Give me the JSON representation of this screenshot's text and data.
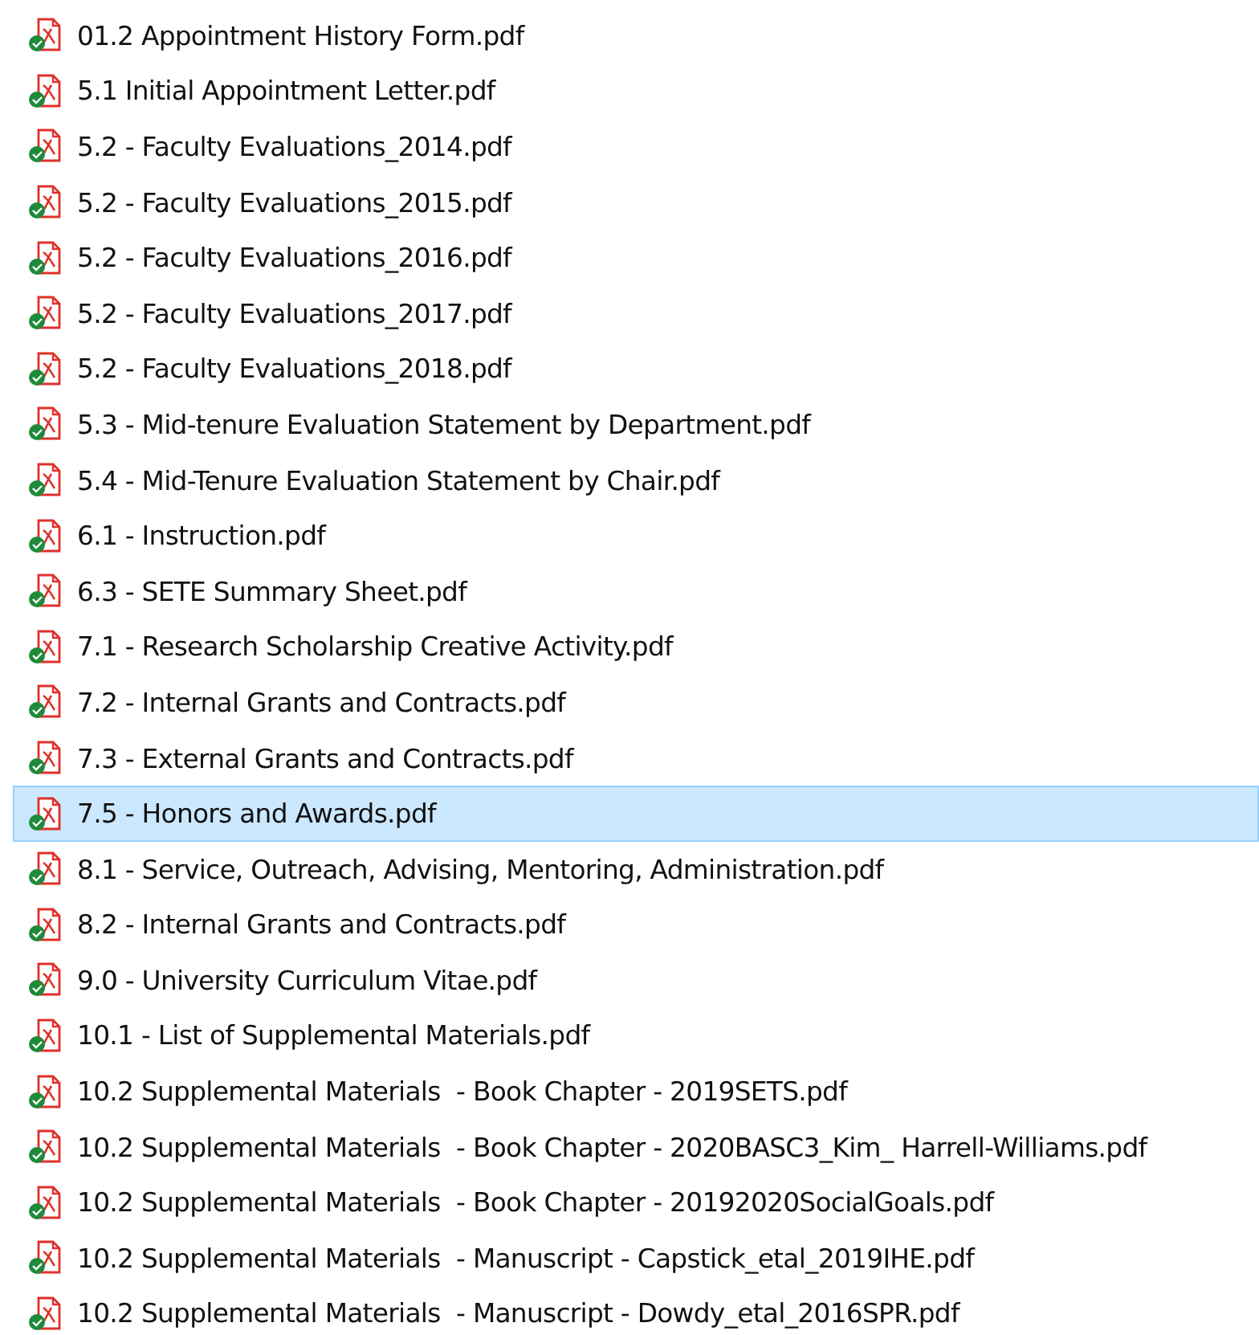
{
  "files": [
    {
      "name": "01.2 Appointment History Form.pdf",
      "selected": false
    },
    {
      "name": "5.1 Initial Appointment Letter.pdf",
      "selected": false
    },
    {
      "name": "5.2 - Faculty Evaluations_2014.pdf",
      "selected": false
    },
    {
      "name": "5.2 - Faculty Evaluations_2015.pdf",
      "selected": false
    },
    {
      "name": "5.2 - Faculty Evaluations_2016.pdf",
      "selected": false
    },
    {
      "name": "5.2 - Faculty Evaluations_2017.pdf",
      "selected": false
    },
    {
      "name": "5.2 - Faculty Evaluations_2018.pdf",
      "selected": false
    },
    {
      "name": "5.3 - Mid-tenure Evaluation Statement by Department.pdf",
      "selected": false
    },
    {
      "name": "5.4 - Mid-Tenure Evaluation Statement by Chair.pdf",
      "selected": false
    },
    {
      "name": "6.1 - Instruction.pdf",
      "selected": false
    },
    {
      "name": "6.3 - SETE Summary Sheet.pdf",
      "selected": false
    },
    {
      "name": "7.1 - Research Scholarship Creative Activity.pdf",
      "selected": false
    },
    {
      "name": "7.2 - Internal Grants and Contracts.pdf",
      "selected": false
    },
    {
      "name": "7.3 - External Grants and Contracts.pdf",
      "selected": false
    },
    {
      "name": "7.5 - Honors and Awards.pdf",
      "selected": true
    },
    {
      "name": "8.1 - Service, Outreach, Advising, Mentoring, Administration.pdf",
      "selected": false
    },
    {
      "name": "8.2 - Internal Grants and Contracts.pdf",
      "selected": false
    },
    {
      "name": "9.0 - University Curriculum Vitae.pdf",
      "selected": false
    },
    {
      "name": "10.1 - List of Supplemental Materials.pdf",
      "selected": false
    },
    {
      "name": "10.2 Supplemental Materials  - Book Chapter - 2019SETS.pdf",
      "selected": false
    },
    {
      "name": "10.2 Supplemental Materials  - Book Chapter - 2020BASC3_Kim_ Harrell-Williams.pdf",
      "selected": false
    },
    {
      "name": "10.2 Supplemental Materials  - Book Chapter - 20192020SocialGoals.pdf",
      "selected": false
    },
    {
      "name": "10.2 Supplemental Materials  - Manuscript - Capstick_etal_2019IHE.pdf",
      "selected": false
    },
    {
      "name": "10.2 Supplemental Materials  - Manuscript - Dowdy_etal_2016SPR.pdf",
      "selected": false
    }
  ]
}
